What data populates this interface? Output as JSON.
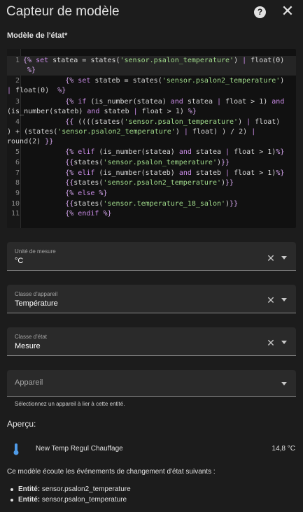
{
  "dialog": {
    "title": "Capteur de modèle",
    "help_icon": "help-circle-icon",
    "close_icon": "close-icon",
    "close_glyph": "✕",
    "help_glyph": "?"
  },
  "state_template": {
    "label": "Modèle de l'état*",
    "lines": [
      {
        "n": "1",
        "text": "{% set statea = states('sensor.psalon_temperature') | float(0) %}"
      },
      {
        "n": "2",
        "text": "        {% set stateb = states('sensor.psalon2_temperature') | float(0)  %}"
      },
      {
        "n": "3",
        "text": "        {% if (is_number(statea) and statea | float > 1) and (is_number(stateb) and stateb | float > 1) %}"
      },
      {
        "n": "4",
        "text": "          {{ ((((states('sensor.psalon_temperature') | float) ) + (states('sensor.psalon2_temperature') | float) ) / 2) | round(2) }}"
      },
      {
        "n": "5",
        "text": "        {% elif (is_number(statea) and statea | float > 1)%}"
      },
      {
        "n": "6",
        "text": "        {{states('sensor.psalon_temperature')}}"
      },
      {
        "n": "7",
        "text": "        {% elif (is_number(stateb) and stateb | float > 1)%}"
      },
      {
        "n": "8",
        "text": "        {{states('sensor.psalon2_temperature')}}"
      },
      {
        "n": "9",
        "text": "        {% else %}"
      },
      {
        "n": "10",
        "text": "        {{states('sensor.temperature_18_salon')}}"
      },
      {
        "n": "11",
        "text": "        {% endif %}"
      }
    ]
  },
  "fields": {
    "unit": {
      "label": "Unité de mesure",
      "value": "°C",
      "clear_glyph": "✕"
    },
    "device_class": {
      "label": "Classe d'appareil",
      "value": "Température",
      "clear_glyph": "✕"
    },
    "state_class": {
      "label": "Classe d'état",
      "value": "Mesure",
      "clear_glyph": "✕"
    },
    "device": {
      "placeholder": "Appareil",
      "helper": "Sélectionnez un appareil à lier à cette entité."
    }
  },
  "preview": {
    "heading": "Aperçu:",
    "entity_icon": "thermometer-icon",
    "entity_name": "New Temp Regul Chauffage",
    "entity_state": "14,8 °C"
  },
  "listeners": {
    "heading": "Ce modèle écoute les événements de changement d'état suivants :",
    "entity_label": "Entité",
    "items": [
      "sensor.psalon2_temperature",
      "sensor.psalon_temperature"
    ]
  },
  "colors": {
    "background": "#1c1c1c",
    "editor_background": "#111111",
    "field_background": "#2a2a2a",
    "accent_thermometer": "#4f9be8",
    "code_keyword": "#c98be6",
    "code_string": "#9fd98a"
  }
}
